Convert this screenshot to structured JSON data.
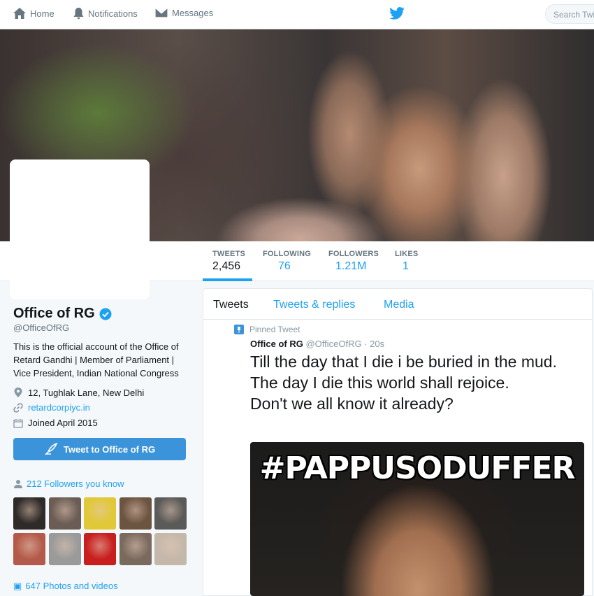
{
  "nav": {
    "home": "Home",
    "notifications": "Notifications",
    "messages": "Messages",
    "search_placeholder": "Search Twi"
  },
  "stats": {
    "tweets_label": "TWEETS",
    "tweets_value": "2,456",
    "following_label": "FOLLOWING",
    "following_value": "76",
    "followers_label": "FOLLOWERS",
    "followers_value": "1.21M",
    "likes_label": "LIKES",
    "likes_value": "1"
  },
  "profile": {
    "name": "Office of RG",
    "handle": "@OfficeOfRG",
    "bio": "This is the official account of the Office of Retard Gandhi | Member of Parliament | Vice President, Indian National Congress",
    "location": "12, Tughlak Lane, New Delhi",
    "url": "retardcorpiyc.in",
    "joined": "Joined April 2015",
    "tweet_to_button": "Tweet to Office of RG",
    "followers_you_know": "212 Followers you know",
    "photos_videos": "647 Photos and videos"
  },
  "timeline": {
    "tabs": [
      "Tweets",
      "Tweets & replies",
      "Media"
    ],
    "pinned_label": "Pinned Tweet",
    "author_name": "Office of RG",
    "author_handle": "@OfficeOfRG",
    "time": "· 20s",
    "text": "Till the day that I die i be buried in the mud.\nThe day I die this world shall rejoice.\nDon't we all know it already?",
    "media_caption": "#PAPPUSODUFFER"
  },
  "colors": {
    "accent": "#1da1f2",
    "button": "#3b94d9",
    "verified": "#1da1f2"
  },
  "thumbnail_tones": [
    [
      "#2e2a28",
      "#6b5d55",
      "#e1c836",
      "#6b5440",
      "#5a5a58"
    ],
    [
      "#b45a4a",
      "#9a9a9a",
      "#c81e1e",
      "#7a6a5e",
      "#c4b8aa"
    ]
  ]
}
